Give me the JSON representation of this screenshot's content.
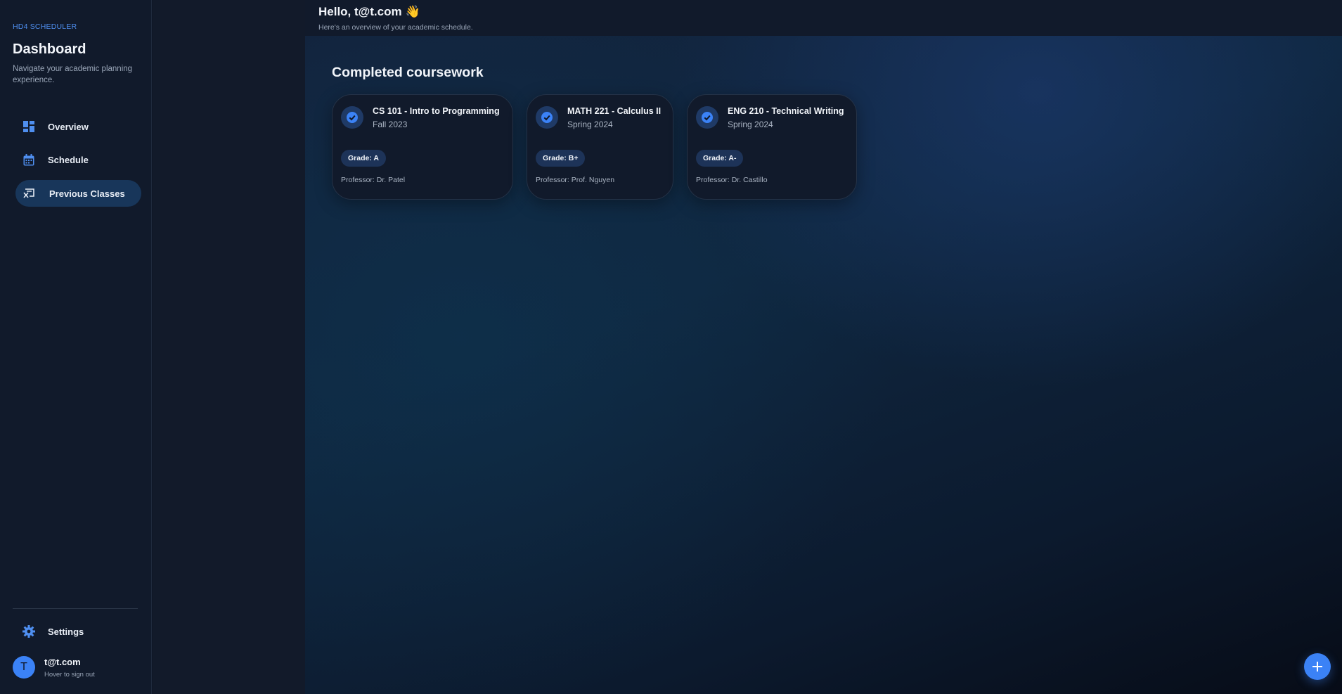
{
  "sidebar": {
    "brand": "HD4 SCHEDULER",
    "title": "Dashboard",
    "subtitle": "Navigate your academic planning experience.",
    "nav": [
      {
        "label": "Overview",
        "icon": "dashboard-icon",
        "active": false
      },
      {
        "label": "Schedule",
        "icon": "calendar-icon",
        "active": false
      },
      {
        "label": "Previous Classes",
        "icon": "history-icon",
        "active": true
      }
    ],
    "settings_label": "Settings",
    "user": {
      "initial": "T",
      "name": "t@t.com",
      "hint": "Hover to sign out"
    }
  },
  "header": {
    "greeting": "Hello, t@t.com",
    "wave": "👋",
    "subtitle": "Here's an overview of your academic schedule."
  },
  "main": {
    "section_title": "Completed coursework",
    "courses": [
      {
        "title": "CS 101 - Intro to Programming",
        "term": "Fall 2023",
        "grade": "Grade: A",
        "professor": "Professor: Dr. Patel"
      },
      {
        "title": "MATH 221 - Calculus II",
        "term": "Spring 2024",
        "grade": "Grade: B+",
        "professor": "Professor: Prof. Nguyen"
      },
      {
        "title": "ENG 210 - Technical Writing",
        "term": "Spring 2024",
        "grade": "Grade: A-",
        "professor": "Professor: Dr. Castillo"
      }
    ]
  },
  "fab": {
    "icon": "plus-icon"
  },
  "colors": {
    "accent": "#3b82f6",
    "brand_text": "#4f8ff0",
    "active_nav": "#18365a",
    "sidebar_bg": "#111a2b"
  }
}
